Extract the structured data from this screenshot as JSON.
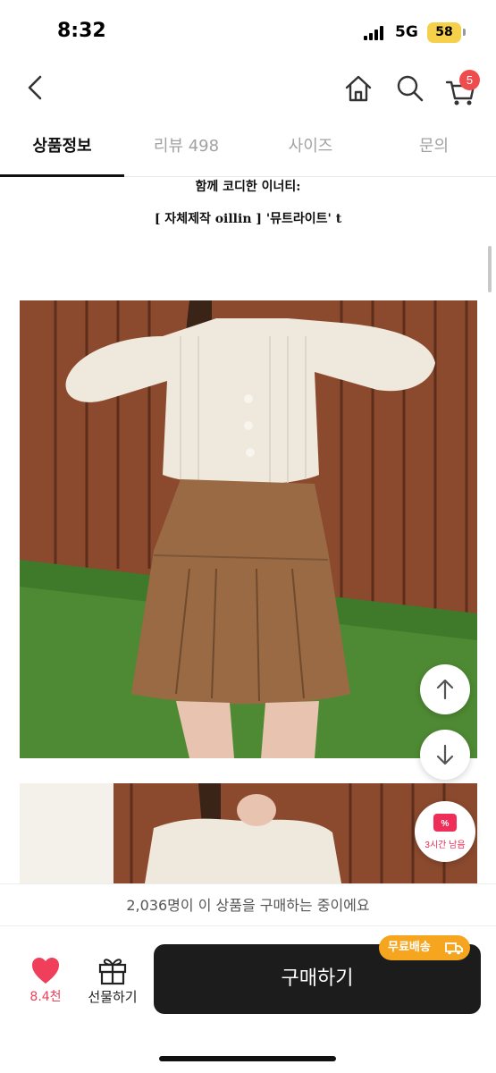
{
  "status_bar": {
    "time": "8:32",
    "network": "5G",
    "battery": "58"
  },
  "nav": {
    "cart_count": "5"
  },
  "tabs": [
    {
      "label": "상품정보",
      "active": true
    },
    {
      "label": "리뷰 498",
      "active": false
    },
    {
      "label": "사이즈",
      "active": false
    },
    {
      "label": "문의",
      "active": false
    }
  ],
  "content": {
    "line1": "함께 코디한 이너티:",
    "line2": "[ 자체제작 oillin ] '뮤트라이트' t"
  },
  "coupon": {
    "label": "3시간 남음"
  },
  "buying_bar": {
    "text": "2,036명이 이 상품을 구매하는 중이에요"
  },
  "bottom": {
    "like_count": "8.4천",
    "gift_label": "선물하기",
    "buy_label": "구매하기",
    "free_shipping_badge": "무료배송"
  },
  "colors": {
    "accent_pink": "#ef3f5a",
    "badge_orange": "#f6a51f",
    "buy_button": "#1c1c1c"
  }
}
